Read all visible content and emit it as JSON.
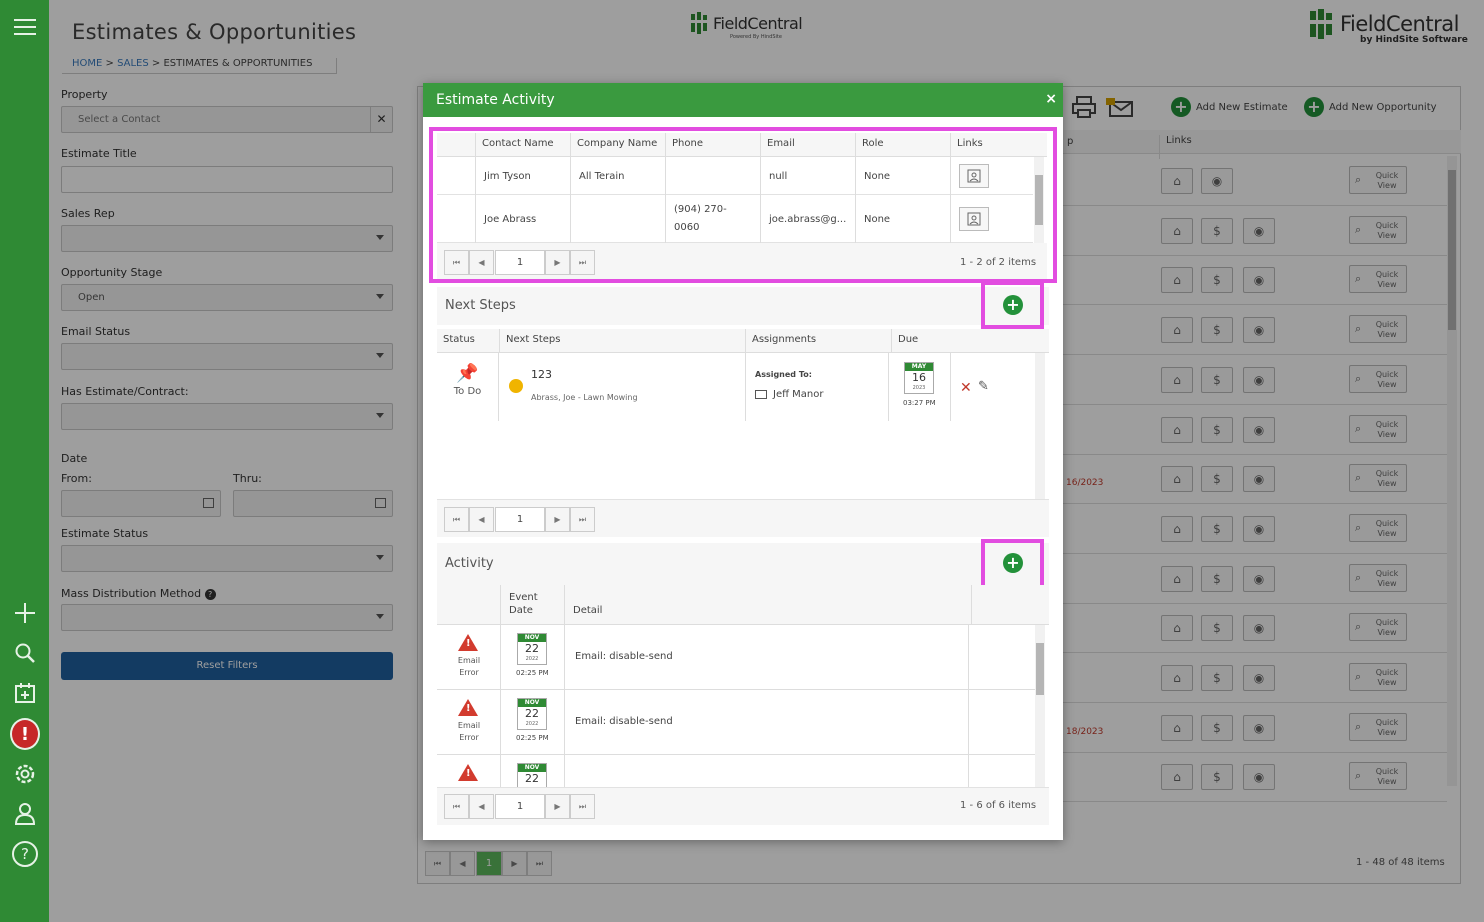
{
  "app": {
    "page_title": "Estimates & Opportunities",
    "logo_center": "FieldCentral",
    "logo_center_sub": "Powered By HindSite",
    "logo_right": "FieldCentral",
    "logo_right_sub": "by HindSite Software"
  },
  "breadcrumb": {
    "home": "HOME",
    "sep1": " > ",
    "sales": "SALES",
    "sep2": " > ",
    "current": "ESTIMATES & OPPORTUNITIES"
  },
  "filters": {
    "property_label": "Property",
    "property_placeholder": "Select a Contact",
    "estimate_title_label": "Estimate Title",
    "sales_rep_label": "Sales Rep",
    "opportunity_stage_label": "Opportunity Stage",
    "opportunity_stage_value": "Open",
    "email_status_label": "Email Status",
    "has_estimate_label": "Has Estimate/Contract:",
    "date_label": "Date",
    "from_label": "From:",
    "thru_label": "Thru:",
    "estimate_status_label": "Estimate Status",
    "mass_dist_label": "Mass Distribution Method",
    "reset_button": "Reset Filters"
  },
  "toolbar": {
    "add_estimate": "Add New Estimate",
    "add_opportunity": "Add New Opportunity"
  },
  "background_grid": {
    "col_p": "p",
    "col_links": "Links",
    "quick_view": "Quick View",
    "date_a": "16/2023",
    "date_b": "18/2023",
    "pager_page": "1",
    "pager_info": "1 - 48 of 48 items"
  },
  "modal": {
    "title": "Estimate Activity",
    "close": "×",
    "contacts": {
      "headers": [
        "Contact Name",
        "Company Name",
        "Phone",
        "Email",
        "Role",
        "Links"
      ],
      "rows": [
        {
          "name": "Jim Tyson",
          "company": "All Terain",
          "phone": "",
          "email": "null",
          "role": "None"
        },
        {
          "name": "Joe Abrass",
          "company": "",
          "phone": "(904) 270-0060",
          "email": "joe.abrass@g...",
          "role": "None"
        }
      ],
      "page": "1",
      "info": "1 - 2 of 2 items"
    },
    "next_steps": {
      "title": "Next Steps",
      "headers": [
        "Status",
        "Next Steps",
        "Assignments",
        "Due"
      ],
      "row": {
        "status": "To Do",
        "name": "123",
        "sub": "Abrass, Joe - Lawn Mowing",
        "assigned_label": "Assigned To:",
        "assignee": "Jeff Manor",
        "due_month": "MAY",
        "due_day": "16",
        "due_year": "2023",
        "due_time": "03:27 PM"
      },
      "page": "1"
    },
    "activity": {
      "title": "Activity",
      "headers": {
        "event_date": "Event Date",
        "detail": "Detail"
      },
      "rows": [
        {
          "type": "Email Error",
          "month": "NOV",
          "day": "22",
          "year": "2022",
          "time": "02:25 PM",
          "detail": "Email: disable-send"
        },
        {
          "type": "Email Error",
          "month": "NOV",
          "day": "22",
          "year": "2022",
          "time": "02:25 PM",
          "detail": "Email: disable-send"
        },
        {
          "type": "",
          "month": "NOV",
          "day": "22",
          "year": "",
          "time": "",
          "detail": ""
        }
      ],
      "page": "1",
      "info": "1 - 6 of 6 items"
    }
  },
  "colors": {
    "sidebar": "#2f8a34",
    "modal_header": "#3a9a3f",
    "highlight": "#e24de0",
    "button": "#1f5f9e"
  }
}
